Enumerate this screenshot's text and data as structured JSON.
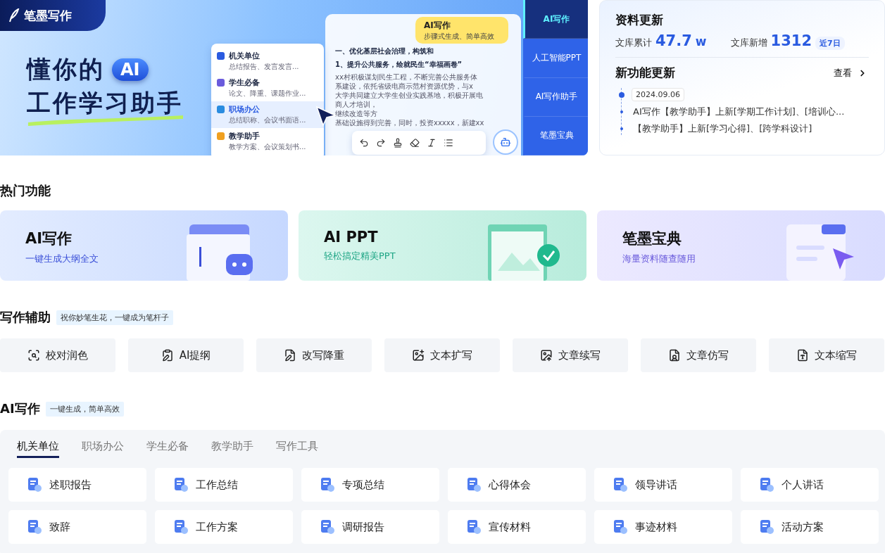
{
  "banner": {
    "logo": "笔墨写作",
    "headline_1": "懂你的",
    "headline_badge": "AI",
    "headline_2": "工作学习助手",
    "menu": [
      {
        "title": "机关单位",
        "subtitle": "总结报告、发言发言...",
        "selected": false
      },
      {
        "title": "学生必备",
        "subtitle": "论文、降重、课题作业...",
        "selected": false
      },
      {
        "title": "职场办公",
        "subtitle": "总结职称、会议书面语...",
        "selected": true
      },
      {
        "title": "教学助手",
        "subtitle": "教学方案、会议策划书...",
        "selected": false
      }
    ],
    "bubble": {
      "title": "AI写作",
      "subtitle": "步骤式生成、简单高效"
    },
    "document": {
      "heading": "一、优化基层社会治理，构筑和",
      "subheading": "1、提升公共服务，绘就民生“幸福画卷”",
      "lines": [
        "xx村积极谋划民生工程，不断完善公共服务体",
        "系建设，依托省级电商示范村资源优势，与x",
        "大学共同建立大学生创业实践基地，积极开展电",
        "商人才培训，",
        "继续改造等方",
        "基础设施得到完善，同时，投资xxxxx，新建xx"
      ]
    },
    "side_tabs": [
      {
        "label": "AI写作",
        "selected": true
      },
      {
        "label": "人工智能PPT",
        "selected": false
      },
      {
        "label": "AI写作助手",
        "selected": false
      },
      {
        "label": "笔墨宝典",
        "selected": false
      }
    ]
  },
  "updates": {
    "title": "资料更新",
    "stats": [
      {
        "label": "文库累计",
        "value": "47.7",
        "unit": "w"
      },
      {
        "label": "文库新增",
        "value": "1312",
        "tag": "近7日"
      }
    ],
    "features_title": "新功能更新",
    "view_link": "查看",
    "date": "2024.09.06",
    "items": [
      "AI写作【教学助手】上新[学期工作计划]、[培训心...",
      "【教学助手】上新[学习心得]、[跨学科设计]"
    ]
  },
  "hot": {
    "title": "热门功能",
    "cards": [
      {
        "kind": "writing",
        "title": "AI写作",
        "subtitle": "一键生成大纲全文"
      },
      {
        "kind": "ppt",
        "title": "AI PPT",
        "subtitle": "轻松搞定精美PPT"
      },
      {
        "kind": "library",
        "title": "笔墨宝典",
        "subtitle": "海量资料随查随用"
      }
    ]
  },
  "assist": {
    "title": "写作辅助",
    "tag": "祝你妙笔生花，一键成为笔杆子",
    "tools": [
      "校对润色",
      "AI提纲",
      "改写降重",
      "文本扩写",
      "文章续写",
      "文章仿写",
      "文本缩写"
    ]
  },
  "ai_writing": {
    "title": "AI写作",
    "tag": "一键生成，简单高效",
    "tabs": [
      {
        "label": "机关单位",
        "selected": true
      },
      {
        "label": "职场办公",
        "selected": false
      },
      {
        "label": "学生必备",
        "selected": false
      },
      {
        "label": "教学助手",
        "selected": false
      },
      {
        "label": "写作工具",
        "selected": false
      }
    ],
    "templates": [
      "述职报告",
      "工作总结",
      "专项总结",
      "心得体会",
      "领导讲话",
      "个人讲话",
      "致辞",
      "工作方案",
      "调研报告",
      "宣传材料",
      "事迹材料",
      "活动方案"
    ]
  }
}
